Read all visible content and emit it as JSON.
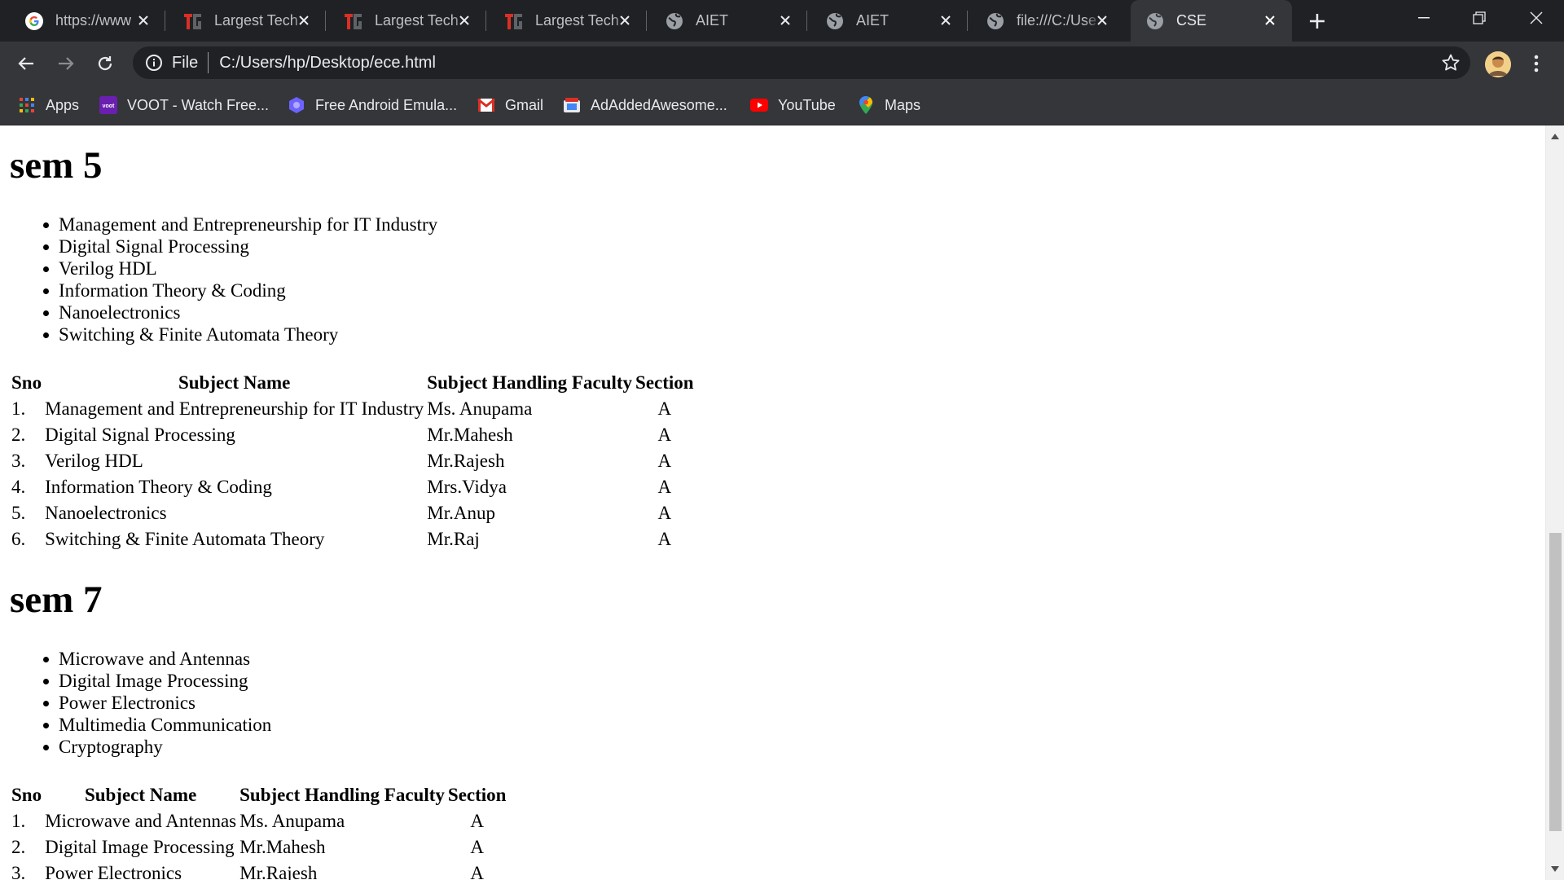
{
  "browser": {
    "tabs": [
      {
        "title": "https://www",
        "icon": "google-icon",
        "active": false
      },
      {
        "title": "Largest Tech",
        "icon": "tg-logo-icon",
        "active": false
      },
      {
        "title": "Largest Tech",
        "icon": "tg-logo-icon",
        "active": false
      },
      {
        "title": "Largest Tech",
        "icon": "tg-logo-icon",
        "active": false
      },
      {
        "title": "AIET",
        "icon": "globe-icon",
        "active": false
      },
      {
        "title": "AIET",
        "icon": "globe-icon",
        "active": false
      },
      {
        "title": "file:///C:/Use",
        "icon": "globe-icon",
        "active": false
      },
      {
        "title": "CSE",
        "icon": "globe-icon",
        "active": true
      }
    ],
    "address": {
      "scheme_label": "File",
      "url": "C:/Users/hp/Desktop/ece.html"
    },
    "bookmarks": [
      {
        "label": "Apps",
        "icon": "apps-grid-icon"
      },
      {
        "label": "VOOT - Watch Free...",
        "icon": "voot-icon"
      },
      {
        "label": "Free Android Emula...",
        "icon": "emulator-icon"
      },
      {
        "label": "Gmail",
        "icon": "gmail-icon"
      },
      {
        "label": "AdAddedAwesome...",
        "icon": "bookmark-site-icon"
      },
      {
        "label": "YouTube",
        "icon": "youtube-icon"
      },
      {
        "label": "Maps",
        "icon": "maps-icon"
      }
    ],
    "colors": {
      "frame": "#202124",
      "toolbar": "#35363a",
      "text": "#e8eaed"
    }
  },
  "page": {
    "sem5": {
      "heading": "sem 5",
      "subjects": [
        "Management and Entrepreneurship for IT Industry",
        "Digital Signal Processing",
        "Verilog HDL",
        "Information Theory & Coding",
        "Nanoelectronics",
        "Switching & Finite Automata Theory"
      ],
      "table": {
        "headers": [
          "Sno",
          "Subject Name",
          "Subject Handling Faculty",
          "Section"
        ],
        "rows": [
          [
            "1.",
            "Management and Entrepreneurship for IT Industry",
            "Ms. Anupama",
            "A"
          ],
          [
            "2.",
            "Digital Signal Processing",
            "Mr.Mahesh",
            "A"
          ],
          [
            "3.",
            "Verilog HDL",
            "Mr.Rajesh",
            "A"
          ],
          [
            "4.",
            "Information Theory & Coding",
            "Mrs.Vidya",
            "A"
          ],
          [
            "5.",
            "Nanoelectronics",
            "Mr.Anup",
            "A"
          ],
          [
            "6.",
            "Switching & Finite Automata Theory",
            "Mr.Raj",
            "A"
          ]
        ]
      }
    },
    "sem7": {
      "heading": "sem 7",
      "subjects": [
        "Microwave and Antennas",
        "Digital Image Processing",
        "Power Electronics",
        "Multimedia Communication",
        "Cryptography"
      ],
      "table": {
        "headers": [
          "Sno",
          "Subject Name",
          "Subject Handling Faculty",
          "Section"
        ],
        "rows": [
          [
            "1.",
            "Microwave and Antennas",
            "Ms. Anupama",
            "A"
          ],
          [
            "2.",
            "Digital Image Processing",
            "Mr.Mahesh",
            "A"
          ],
          [
            "3.",
            "Power Electronics",
            "Mr.Rajesh",
            "A"
          ]
        ]
      }
    }
  }
}
